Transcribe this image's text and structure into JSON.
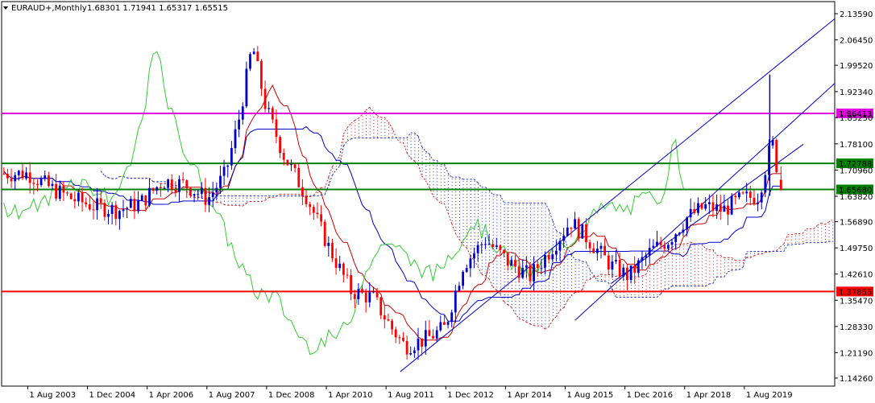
{
  "header": {
    "symbol": "EURAUD+,Monthly",
    "ohlc": "1.68301 1.71941 1.65317 1.65515"
  },
  "chart_data": {
    "type": "candlestick",
    "symbol": "EURAUD+",
    "timeframe": "Monthly",
    "open": 1.68301,
    "high": 1.71941,
    "low": 1.65317,
    "close": 1.65515,
    "ylim": [
      1.1426,
      2.1359
    ],
    "y_ticks": [
      "2.13590",
      "2.06450",
      "1.99520",
      "1.92340",
      "1.85250",
      "1.78100",
      "1.70960",
      "1.63820",
      "1.56890",
      "1.49750",
      "1.42610",
      "1.35470",
      "1.28330",
      "1.21190",
      "1.14260"
    ],
    "x_ticks": [
      "1 Aug 2003",
      "1 Dec 2004",
      "1 Apr 2006",
      "1 Aug 2007",
      "1 Dec 2008",
      "1 Apr 2010",
      "1 Aug 2011",
      "1 Dec 2012",
      "1 Apr 2014",
      "1 Aug 2015",
      "1 Dec 2016",
      "1 Apr 2018",
      "1 Aug 2019"
    ],
    "levels": [
      {
        "label": "1.86413",
        "value": 1.86413,
        "color": "#e000e0"
      },
      {
        "label": "1.72788",
        "value": 1.72788,
        "color": "#008000"
      },
      {
        "label": "1.65680",
        "value": 1.6568,
        "color": "#008000"
      },
      {
        "label": "1.37855",
        "value": 1.37855,
        "color": "#ff0000"
      }
    ],
    "channel": [
      {
        "start": [
          2011.9,
          1.16
        ],
        "end": [
          2021.6,
          2.122
        ]
      },
      {
        "start": [
          2015.8,
          1.3
        ],
        "end": [
          2021.6,
          1.946
        ]
      },
      {
        "start": [
          2016.6,
          1.4
        ],
        "end": [
          2020.9,
          1.78
        ]
      }
    ],
    "price_path": [
      [
        2003.6,
        1.7
      ],
      [
        2004.1,
        1.66
      ],
      [
        2004.6,
        1.63
      ],
      [
        2005.1,
        1.61
      ],
      [
        2005.6,
        1.6
      ],
      [
        2006.1,
        1.62
      ],
      [
        2006.6,
        1.68
      ],
      [
        2007.1,
        1.67
      ],
      [
        2007.6,
        1.63
      ],
      [
        2008.0,
        1.7
      ],
      [
        2008.3,
        1.85
      ],
      [
        2008.6,
        2.05
      ],
      [
        2008.9,
        1.88
      ],
      [
        2009.3,
        1.75
      ],
      [
        2009.8,
        1.64
      ],
      [
        2010.3,
        1.5
      ],
      [
        2010.8,
        1.38
      ],
      [
        2011.3,
        1.36
      ],
      [
        2011.7,
        1.28
      ],
      [
        2012.0,
        1.23
      ],
      [
        2012.5,
        1.25
      ],
      [
        2012.9,
        1.28
      ],
      [
        2013.3,
        1.45
      ],
      [
        2013.8,
        1.52
      ],
      [
        2014.3,
        1.46
      ],
      [
        2014.8,
        1.42
      ],
      [
        2015.3,
        1.5
      ],
      [
        2015.7,
        1.57
      ],
      [
        2016.1,
        1.52
      ],
      [
        2016.6,
        1.45
      ],
      [
        2017.0,
        1.42
      ],
      [
        2017.5,
        1.49
      ],
      [
        2017.9,
        1.52
      ],
      [
        2018.3,
        1.58
      ],
      [
        2018.7,
        1.61
      ],
      [
        2019.1,
        1.6
      ],
      [
        2019.5,
        1.63
      ],
      [
        2019.9,
        1.64
      ],
      [
        2020.2,
        1.79
      ],
      [
        2020.4,
        1.655
      ]
    ],
    "spike": {
      "x": 2020.15,
      "high": 1.97,
      "low": 1.64
    }
  },
  "colors": {
    "up": "#0000cc",
    "down": "#ff0000",
    "tenkan": "#cc0000",
    "kijun": "#0000cc",
    "chikou": "#33cc33",
    "cloud_bull": "#cc2222",
    "cloud_bear": "#2233cc"
  }
}
